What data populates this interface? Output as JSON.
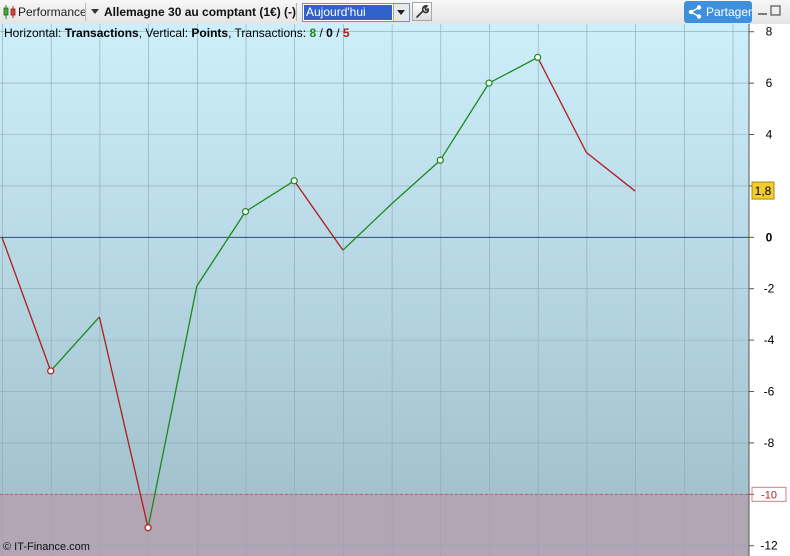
{
  "toolbar": {
    "performance_label": "Performance",
    "instrument_label": "Allemagne 30 au comptant (1€) (-)",
    "period_value": "Aujourd'hui",
    "share_label": "Partager"
  },
  "info": {
    "h_prefix": "Horizontal: ",
    "h_value": "Transactions",
    "v_prefix": ", Vertical: ",
    "v_value": "Points",
    "t_prefix": ", Transactions: ",
    "wins": "8",
    "sep1": " / ",
    "flat": "0",
    "sep2": " / ",
    "losses": "5"
  },
  "watermark": "© IT-Finance.com",
  "colors": {
    "win": "#1a8a1a",
    "loss": "#b01c1c",
    "zero_line": "#2a3fdc",
    "drawdown_zone": "#b3a6b4",
    "last_badge": "#f3cc2e"
  },
  "chart_data": {
    "type": "line",
    "x_label": "Transactions",
    "y_label": "Points",
    "x": [
      0,
      1,
      2,
      3,
      4,
      5,
      6,
      7,
      8,
      9,
      10,
      11,
      12,
      13
    ],
    "y": [
      0,
      -5.2,
      -3.1,
      -11.3,
      -1.9,
      1.0,
      2.2,
      -0.5,
      1.3,
      3.0,
      6.0,
      7.0,
      3.3,
      1.8
    ],
    "markers_at": [
      1,
      3,
      5,
      6,
      9,
      10,
      11
    ],
    "ylim": [
      -12.4,
      8.3
    ],
    "y_ticks": [
      8,
      6,
      4,
      2,
      0,
      -2,
      -4,
      -6,
      -8,
      -10,
      -12
    ],
    "y_tick_labels": [
      "8",
      "6",
      "4",
      "2",
      "0",
      "-2",
      "-4",
      "-6",
      "-8",
      "-10",
      "-12"
    ],
    "zero_line": 0,
    "drawdown_threshold": -10,
    "drawdown_label": "-10",
    "last_value_label": "1,8",
    "grid": true
  }
}
